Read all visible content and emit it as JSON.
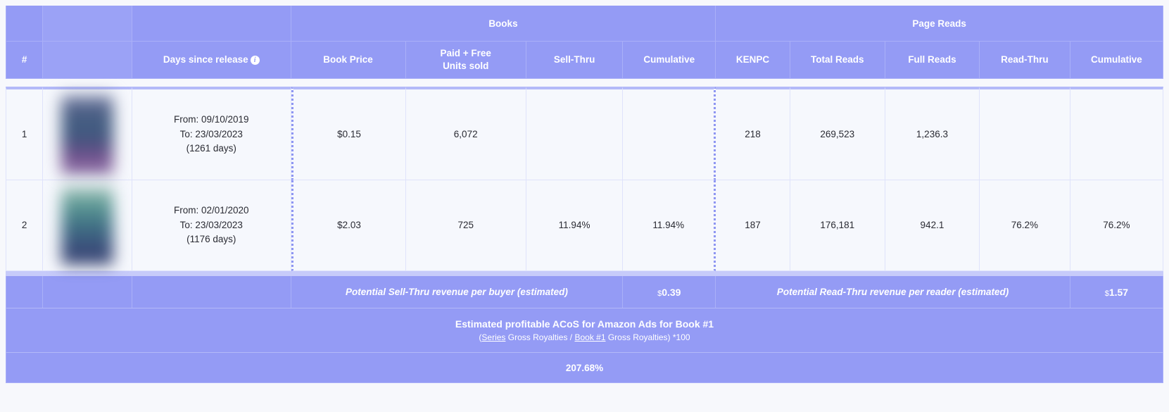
{
  "table": {
    "group_headers": {
      "blank1": "",
      "blank2": "",
      "blank3": "",
      "books": "Books",
      "page_reads": "Page Reads"
    },
    "columns": {
      "index": "#",
      "cover": "",
      "days_since_release": "Days since release",
      "days_info_icon": "info-icon",
      "book_price": "Book Price",
      "units_sold": "Paid + Free\nUnits sold",
      "units_sold_line1": "Paid + Free",
      "units_sold_line2": "Units sold",
      "sell_thru": "Sell-Thru",
      "cumulative_books": "Cumulative",
      "kenpc": "KENPC",
      "total_reads": "Total Reads",
      "full_reads": "Full Reads",
      "read_thru": "Read-Thru",
      "cumulative_reads": "Cumulative"
    },
    "rows": [
      {
        "index": "1",
        "cover_icon": "book-cover-thumbnail",
        "from_label": "From: 09/10/2019",
        "to_label": "To: 23/03/2023",
        "days_label": "(1261 days)",
        "book_price": "$0.15",
        "units_sold": "6,072",
        "sell_thru": "",
        "cumulative_books": "",
        "kenpc": "218",
        "total_reads": "269,523",
        "full_reads": "1,236.3",
        "read_thru": "",
        "cumulative_reads": ""
      },
      {
        "index": "2",
        "cover_icon": "book-cover-thumbnail",
        "from_label": "From: 02/01/2020",
        "to_label": "To: 23/03/2023",
        "days_label": "(1176 days)",
        "book_price": "$2.03",
        "units_sold": "725",
        "sell_thru": "11.94%",
        "cumulative_books": "11.94%",
        "kenpc": "187",
        "total_reads": "176,181",
        "full_reads": "942.1",
        "read_thru": "76.2%",
        "cumulative_reads": "76.2%"
      }
    ],
    "summary": {
      "sell_thru_label": "Potential Sell-Thru revenue per buyer (estimated)",
      "sell_thru_currency": "$",
      "sell_thru_value": "0.39",
      "read_thru_label": "Potential Read-Thru revenue per reader (estimated)",
      "read_thru_currency": "$",
      "read_thru_value": "1.57"
    },
    "acos": {
      "title": "Estimated profitable ACoS for Amazon Ads for Book #1",
      "formula_open": "(",
      "formula_link1": "Series",
      "formula_mid1": " Gross Royalties / ",
      "formula_link2": "Book #1",
      "formula_mid2": " Gross Royalties",
      "formula_close": ") *100",
      "value": "207.68%"
    }
  },
  "colors": {
    "header_purple": "#949bf5",
    "header_border": "#aab0f8",
    "body_bg": "#f6f8fd",
    "body_border": "#dfe3fb",
    "page_bg": "#f7f8fc",
    "dashed_divider": "#8e96f2",
    "text_dark": "#2a2b33",
    "text_light": "#ffffff"
  }
}
